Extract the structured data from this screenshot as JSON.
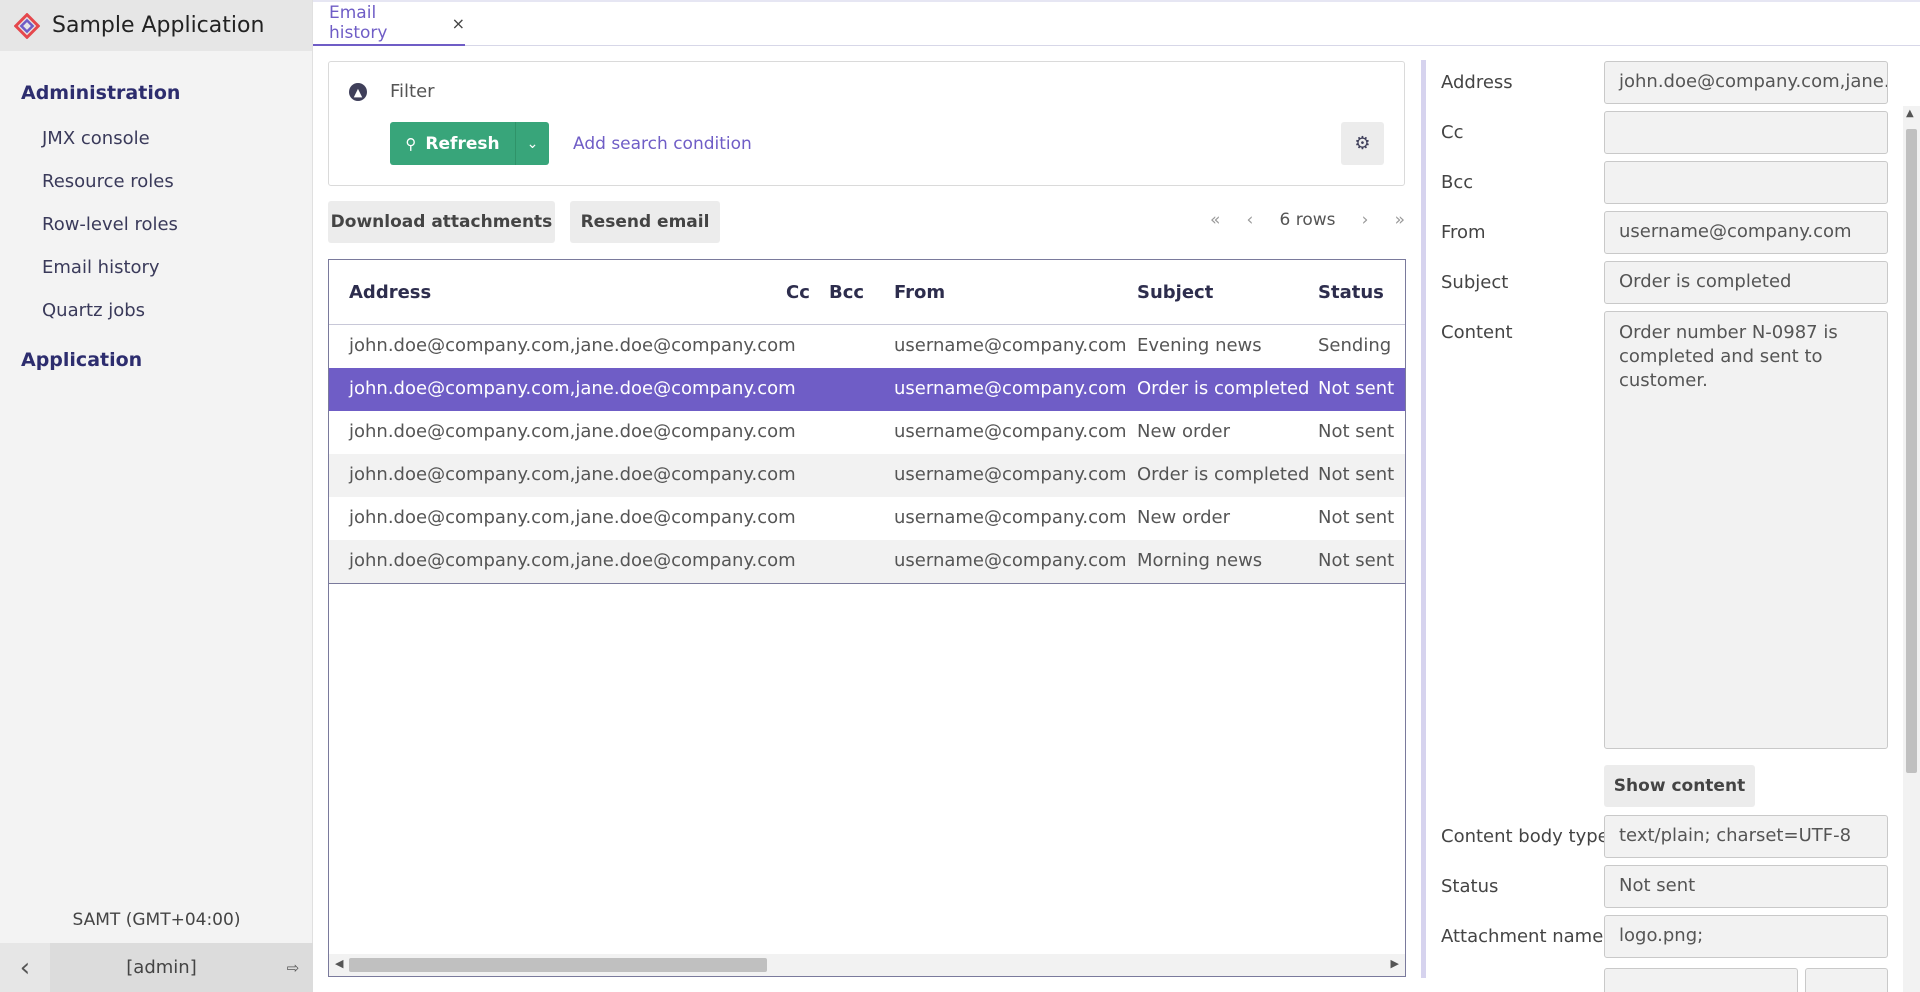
{
  "app": {
    "title": "Sample Application"
  },
  "sidebar": {
    "groups": [
      {
        "label": "Administration",
        "items": [
          "JMX console",
          "Resource roles",
          "Row-level roles",
          "Email history",
          "Quartz jobs"
        ]
      },
      {
        "label": "Application",
        "items": []
      }
    ],
    "timezone": "SAMT (GMT+04:00)",
    "user": "[admin]"
  },
  "tabs": [
    {
      "label": "Email history",
      "close": "×"
    }
  ],
  "filter": {
    "label": "Filter",
    "refresh_label": "Refresh",
    "add_condition_label": "Add search condition"
  },
  "actions": {
    "download_label": "Download attachments",
    "resend_label": "Resend email"
  },
  "pager": {
    "first": "«",
    "prev": "‹",
    "rows": "6 rows",
    "next": "›",
    "last": "»"
  },
  "table": {
    "columns": [
      "Address",
      "Cc",
      "Bcc",
      "From",
      "Subject",
      "Status"
    ],
    "rows": [
      {
        "address": "john.doe@company.com,jane.doe@company.com",
        "cc": "",
        "bcc": "",
        "from": "username@company.com",
        "subject": "Evening news",
        "status": "Sending"
      },
      {
        "address": "john.doe@company.com,jane.doe@company.com",
        "cc": "",
        "bcc": "",
        "from": "username@company.com",
        "subject": "Order is completed",
        "status": "Not sent"
      },
      {
        "address": "john.doe@company.com,jane.doe@company.com",
        "cc": "",
        "bcc": "",
        "from": "username@company.com",
        "subject": "New order",
        "status": "Not sent"
      },
      {
        "address": "john.doe@company.com,jane.doe@company.com",
        "cc": "",
        "bcc": "",
        "from": "username@company.com",
        "subject": "Order is completed",
        "status": "Not sent"
      },
      {
        "address": "john.doe@company.com,jane.doe@company.com",
        "cc": "",
        "bcc": "",
        "from": "username@company.com",
        "subject": "New order",
        "status": "Not sent"
      },
      {
        "address": "john.doe@company.com,jane.doe@company.com",
        "cc": "",
        "bcc": "",
        "from": "username@company.com",
        "subject": "Morning news",
        "status": "Not sent"
      }
    ]
  },
  "detail": {
    "address_label": "Address",
    "address_value": "john.doe@company.com,jane.doe@company.com",
    "cc_label": "Cc",
    "cc_value": "",
    "bcc_label": "Bcc",
    "bcc_value": "",
    "from_label": "From",
    "from_value": "username@company.com",
    "subject_label": "Subject",
    "subject_value": "Order is completed",
    "content_label": "Content",
    "content_value": "Order number N-0987 is completed and sent to customer.",
    "show_content_label": "Show content",
    "content_body_type_label": "Content body type",
    "content_body_type_value": "text/plain; charset=UTF-8",
    "status_label": "Status",
    "status_value": "Not sent",
    "attachment_names_label": "Attachment names",
    "attachment_names_value": "logo.png;"
  },
  "colors": {
    "accent": "#6f5dc6",
    "primary_button": "#38a57a",
    "sidebar_bg": "#f3f3f3"
  }
}
